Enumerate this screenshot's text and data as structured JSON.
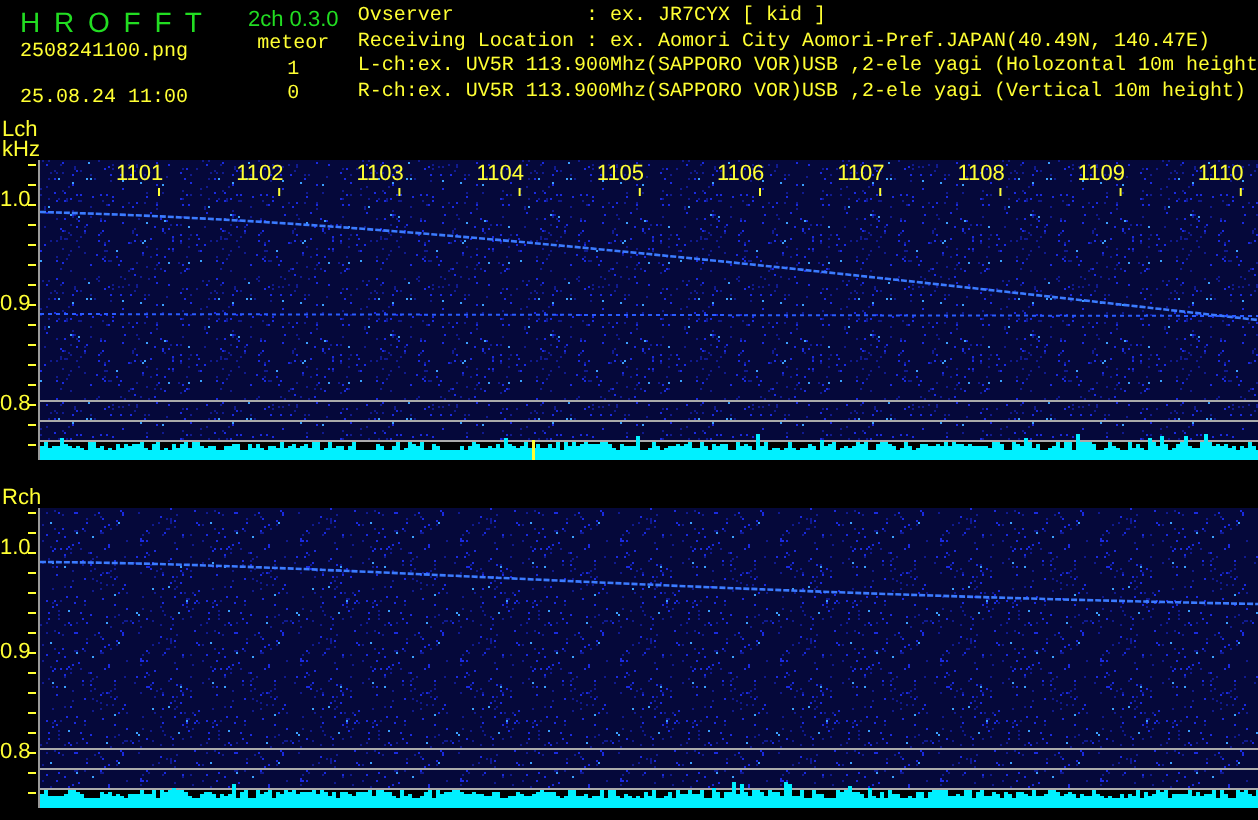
{
  "app": {
    "title": "H R O F F T",
    "version": "2ch 0.3.0",
    "file": "2508241100.png",
    "timestamp": "25.08.24 11:00",
    "counter_label": "meteor"
  },
  "info": [
    {
      "label": "Ovserver",
      "value": ": ex. JR7CYX [ kid ]"
    },
    {
      "label": "Receiving Location",
      "value": ": ex. Aomori City Aomori-Pref.JAPAN(40.49N, 140.47E)"
    }
  ],
  "channel_info": [
    "L-ch:ex. UV5R 113.900Mhz(SAPPORO VOR)USB ,2-ele yagi (Holozontal 10m height",
    "R-ch:ex. UV5R 113.900Mhz(SAPPORO VOR)USB ,2-ele yagi (Vertical 10m height)"
  ],
  "channels": [
    {
      "label": "Lch",
      "unit": "kHz",
      "count": "1",
      "time_labels": [
        "1101",
        "1102",
        "1103",
        "1104",
        "1105",
        "1106",
        "1107",
        "1108",
        "1109",
        "1110"
      ],
      "freq_labels": [
        "1.0",
        "0.9",
        "0.8"
      ]
    },
    {
      "label": "Rch",
      "count": "0",
      "freq_labels": [
        "1.0",
        "0.9",
        "0.8"
      ]
    }
  ]
}
